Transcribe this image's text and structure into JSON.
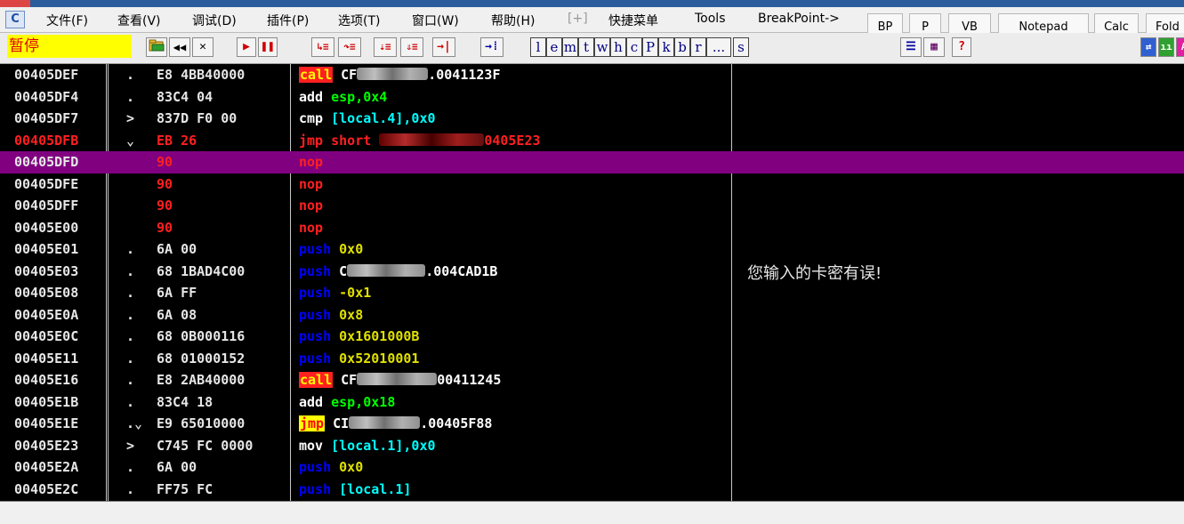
{
  "menubar": {
    "app_icon": "C",
    "items": [
      "文件(F)",
      "查看(V)",
      "调试(D)",
      "插件(P)",
      "选项(T)",
      "窗口(W)",
      "帮助(H)",
      "[+]",
      "快捷菜单",
      "Tools",
      "BreakPoint->"
    ],
    "quick_buttons": [
      "BP",
      "P",
      "VB",
      "Notepad",
      "Calc",
      "Fold"
    ]
  },
  "toolbar": {
    "status": "暂停",
    "letters": [
      "l",
      "e",
      "m",
      "t",
      "w",
      "h",
      "c",
      "P",
      "k",
      "b",
      "r",
      "...",
      "s"
    ],
    "help": "?"
  },
  "cpu": {
    "rows": [
      {
        "addr": "00405DEF",
        "mark": ".",
        "hex": "E8 4BB40000",
        "mnem": "call",
        "op_pre": "CF",
        "op_post": ".0041123F"
      },
      {
        "addr": "00405DF4",
        "mark": ".",
        "hex": "83C4 04",
        "mnem": "add",
        "op": "esp,0x4"
      },
      {
        "addr": "00405DF7",
        "mark": ">",
        "hex": "837D F0 00",
        "mnem": "cmp",
        "op": "[local.4],0x0"
      },
      {
        "addr": "00405DFB",
        "mark": "⌄",
        "hex": "EB 26",
        "mnem": "jmp short",
        "op_post": "0405E23"
      },
      {
        "addr": "00405DFD",
        "mark": "",
        "hex": "90",
        "mnem": "nop"
      },
      {
        "addr": "00405DFE",
        "mark": "",
        "hex": "90",
        "mnem": "nop"
      },
      {
        "addr": "00405DFF",
        "mark": "",
        "hex": "90",
        "mnem": "nop"
      },
      {
        "addr": "00405E00",
        "mark": "",
        "hex": "90",
        "mnem": "nop"
      },
      {
        "addr": "00405E01",
        "mark": ".",
        "hex": "6A 00",
        "mnem": "push",
        "op": "0x0"
      },
      {
        "addr": "00405E03",
        "mark": ".",
        "hex": "68 1BAD4C00",
        "mnem": "push",
        "op_pre": "C",
        "op_post": ".004CAD1B",
        "comment": "您输入的卡密有误!"
      },
      {
        "addr": "00405E08",
        "mark": ".",
        "hex": "6A FF",
        "mnem": "push",
        "op": "-0x1"
      },
      {
        "addr": "00405E0A",
        "mark": ".",
        "hex": "6A 08",
        "mnem": "push",
        "op": "0x8"
      },
      {
        "addr": "00405E0C",
        "mark": ".",
        "hex": "68 0B000116",
        "mnem": "push",
        "op": "0x1601000B"
      },
      {
        "addr": "00405E11",
        "mark": ".",
        "hex": "68 01000152",
        "mnem": "push",
        "op": "0x52010001"
      },
      {
        "addr": "00405E16",
        "mark": ".",
        "hex": "E8 2AB40000",
        "mnem": "call",
        "op_pre": "CF",
        "op_post": "00411245"
      },
      {
        "addr": "00405E1B",
        "mark": ".",
        "hex": "83C4 18",
        "mnem": "add",
        "op": "esp,0x18"
      },
      {
        "addr": "00405E1E",
        "mark": ".⌄",
        "hex": "E9 65010000",
        "mnem": "jmp",
        "op_pre": "CI",
        "op_post": ".00405F88"
      },
      {
        "addr": "00405E23",
        "mark": ">",
        "hex": "C745 FC 0000",
        "mnem": "mov",
        "op": "[local.1],0x0"
      },
      {
        "addr": "00405E2A",
        "mark": ".",
        "hex": "6A 00",
        "mnem": "push",
        "op": "0x0"
      },
      {
        "addr": "00405E2C",
        "mark": ".",
        "hex": "FF75 FC",
        "mnem": "push",
        "op": "[local.1]"
      }
    ]
  },
  "colors": {
    "selection": "#800080",
    "status_bg": "#ffff00",
    "pane_bg": "#000000"
  }
}
